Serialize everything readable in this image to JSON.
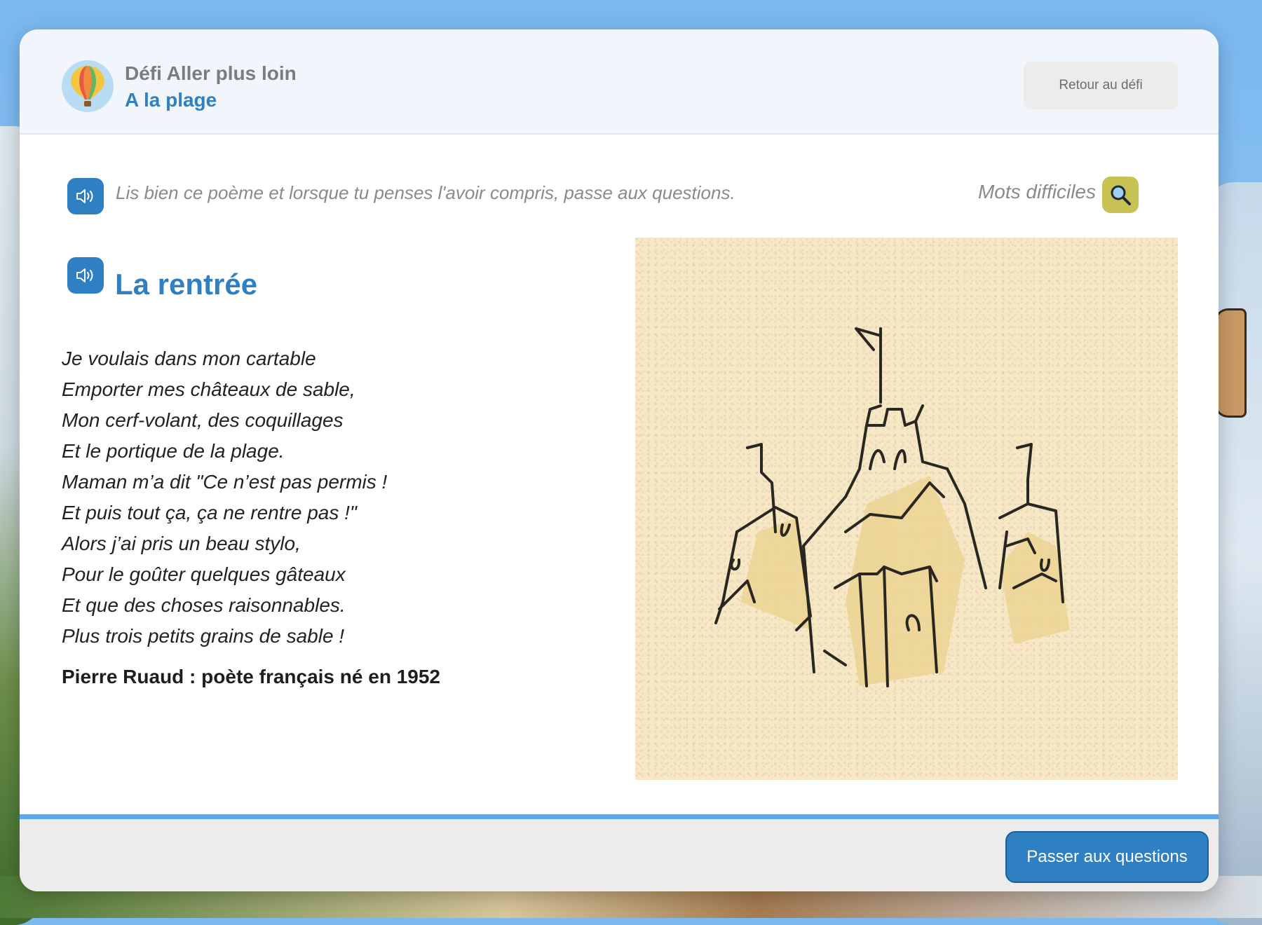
{
  "header": {
    "supertitle": "Défi Aller plus loin",
    "title": "A la plage",
    "back_label": "Retour au défi"
  },
  "instruction": {
    "text": "Lis bien ce poème et lorsque tu penses l'avoir compris, passe aux questions.",
    "difficult_words_label": "Mots difficiles"
  },
  "poem": {
    "title": "La rentrée",
    "lines": [
      "Je voulais dans mon cartable",
      "Emporter mes châteaux de sable,",
      "Mon cerf-volant, des coquillages",
      "Et le portique de la plage.",
      "Maman m’a dit \"Ce n’est pas permis !",
      "Et puis tout ça, ça ne rentre pas !\"",
      "Alors j’ai pris un beau stylo,",
      "Pour le goûter quelques gâteaux",
      "Et que des choses raisonnables.",
      "Plus trois petits grains de sable !"
    ],
    "author": "Pierre Ruaud : poète français né en 1952"
  },
  "icons": {
    "sound": "speaker-icon",
    "search": "magnifier-icon",
    "logo": "hot-air-balloon-icon",
    "illustration": "sand-castle-illustration"
  },
  "colors": {
    "primary": "#2f7fc3",
    "search_button": "#c8c154",
    "footer_line": "#5fa6e8"
  },
  "footer": {
    "next_label": "Passer aux questions"
  }
}
